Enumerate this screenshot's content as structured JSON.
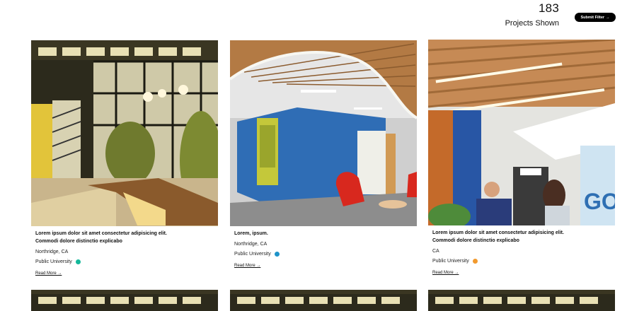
{
  "header": {
    "count": "183",
    "count_label": "Projects Shown",
    "submit_label": "Submit Filter",
    "submit_arrow": "→"
  },
  "cards": [
    {
      "title_line1": "Lorem ipsum dolor sit amet consectetur adipisicing elit.",
      "title_line2": "Commodi dolore distinctio explicabo",
      "location": "Northridge, CA",
      "type": "Public University",
      "type_color": "#15b89a",
      "read_more": "Read More →",
      "image_icon": "courtyard-night-photo"
    },
    {
      "title_line1": "Lorem, ipsum.",
      "title_line2": "",
      "location": "Northridge, CA",
      "type": "Public University",
      "type_color": "#1e93c9",
      "read_more": "Read More →",
      "image_icon": "interior-lounge-photo"
    },
    {
      "title_line1": "Lorem ipsum dolor sit amet consectetur adipisicing elit.",
      "title_line2": "Commodi dolore distinctio explicabo",
      "location": "CA",
      "type": "Public University",
      "type_color": "#f29a2e",
      "read_more": "Read More →",
      "image_icon": "office-interior-photo"
    }
  ]
}
